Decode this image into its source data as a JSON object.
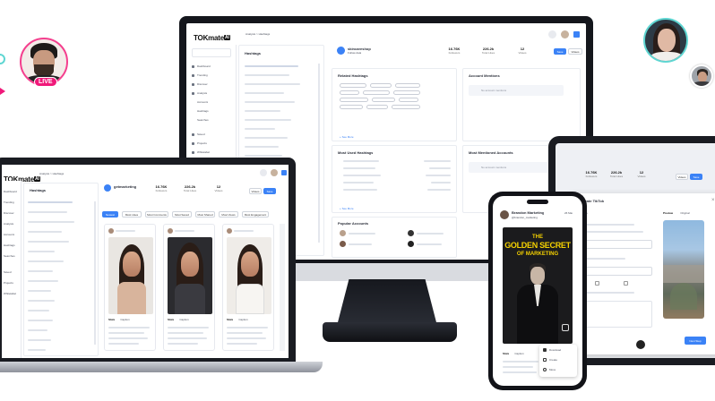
{
  "app": {
    "logo_text": "TOKmate",
    "logo_mark": "AI",
    "page_title": "Hashtags",
    "breadcrumb": "Analysis > Hashtags"
  },
  "monitor": {
    "account_name": "skincareshop",
    "account_sub": "Follow data",
    "stats": [
      {
        "value": "16.76K",
        "label": "Followers"
      },
      {
        "value": "226.2k",
        "label": "Total Likes"
      },
      {
        "value": "12",
        "label": "Videos"
      }
    ],
    "buttons": {
      "primary": "Save",
      "secondary": "Videos"
    },
    "sections": {
      "related": "Related Hashtags",
      "mentions": "Account Mentions",
      "most_used": "Most Used Hashtags",
      "most_mentioned": "Most Mentioned Accounts",
      "popular": "Popular Accounts"
    },
    "see_more": "+ See More",
    "empty_text": "No account mentions"
  },
  "sidebar": {
    "items": [
      "Dashboard",
      "Trending",
      "Discover",
      "Analysis",
      "Accounts",
      "Hashtags",
      "Searches",
      "Saved",
      "Projects",
      "Whitelabel"
    ]
  },
  "laptop": {
    "account_name": "getmarketing",
    "stats": [
      {
        "value": "16.76K",
        "label": "Followers"
      },
      {
        "value": "226.2k",
        "label": "Total Likes"
      },
      {
        "value": "12",
        "label": "Videos"
      }
    ],
    "filters": [
      "Newest",
      "Most Likes",
      "Most Comments",
      "Most Saved",
      "Most Shared",
      "Most Views",
      "Most Engagement"
    ],
    "card_tabs": [
      "Stats",
      "Caption"
    ]
  },
  "phone": {
    "account_name": "Brandon Marketing",
    "account_handle": "@brandon_marketing",
    "date": "26 Mar",
    "poster": {
      "line1": "THE",
      "line2": "GOLDEN SECRET",
      "line3": "OF MARKETING"
    },
    "tabs": [
      "Stats",
      "Caption"
    ],
    "menu": [
      "Download",
      "Create",
      "Move"
    ]
  },
  "tablet": {
    "stats": [
      {
        "value": "16.76K",
        "label": "Followers"
      },
      {
        "value": "226.2k",
        "label": "Total Likes"
      },
      {
        "value": "12",
        "label": "Videos"
      }
    ],
    "dialog_title": "Create TikTok",
    "tabs": [
      "Video",
      "Preview",
      "Original"
    ],
    "action": "Next Step"
  },
  "live_badge": "LIVE",
  "colors": {
    "accent": "#3b82f6",
    "live": "#f0197a",
    "ring_teal": "#5fd6d2",
    "poster_yellow": "#f5d100"
  }
}
